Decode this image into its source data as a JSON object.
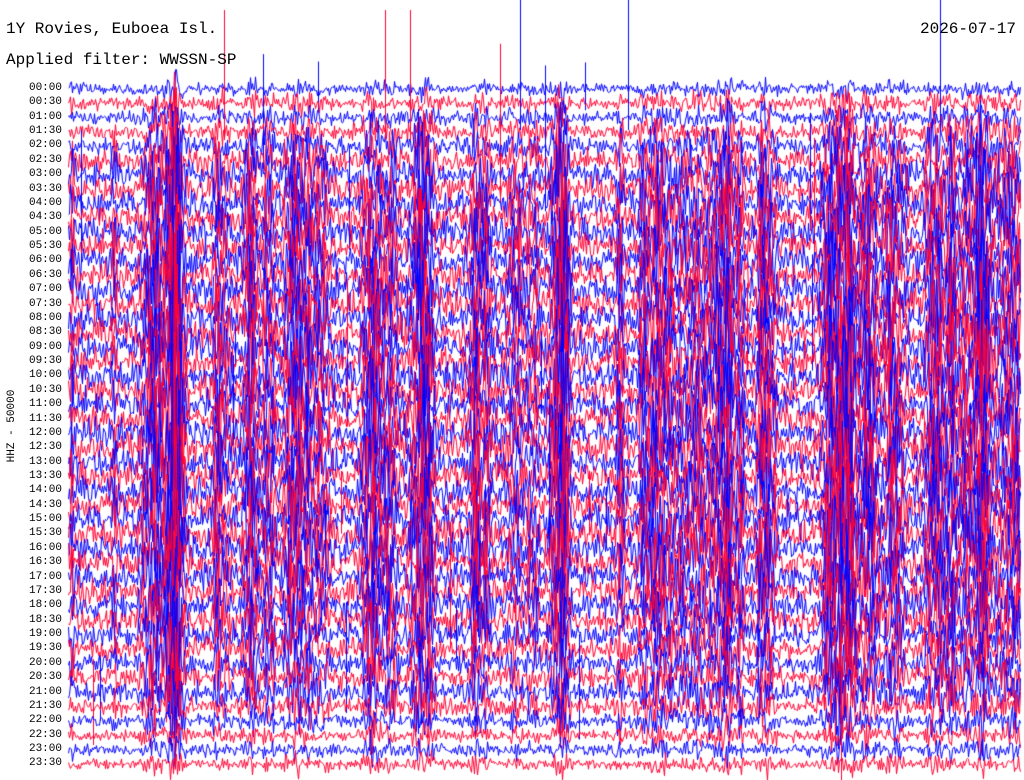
{
  "header": {
    "station": "1Y Rovies, Euboea Isl.",
    "filter": "Applied filter: WWSSN-SP",
    "date": "2026-07-17"
  },
  "chart_data": {
    "type": "line",
    "title": "1Y Rovies, Euboea Isl.",
    "subtitle": "Applied filter: WWSSN-SP",
    "ylabel": "HHZ - 50000",
    "row_labels": [
      "00:00",
      "00:30",
      "01:00",
      "01:30",
      "02:00",
      "02:30",
      "03:00",
      "03:30",
      "04:00",
      "04:30",
      "05:00",
      "05:30",
      "06:00",
      "06:30",
      "07:00",
      "07:30",
      "08:00",
      "08:30",
      "09:00",
      "09:30",
      "10:00",
      "10:30",
      "11:00",
      "11:30",
      "12:00",
      "12:30",
      "13:00",
      "13:30",
      "14:00",
      "14:30",
      "15:00",
      "15:30",
      "16:00",
      "16:30",
      "17:00",
      "17:30",
      "18:00",
      "18:30",
      "19:00",
      "19:30",
      "20:00",
      "20:30",
      "21:00",
      "21:30",
      "22:00",
      "22:30",
      "23:00",
      "23:30"
    ],
    "row_colors": [
      "#0000ff",
      "#ff0033"
    ],
    "row_activity": [
      0.18,
      0.3,
      0.32,
      0.45,
      0.6,
      0.8,
      0.95,
      1.0,
      1.05,
      1.1,
      1.1,
      1.1,
      1.15,
      1.15,
      1.2,
      1.2,
      1.2,
      1.2,
      1.2,
      1.2,
      1.2,
      1.2,
      1.2,
      1.2,
      1.2,
      1.2,
      1.2,
      1.2,
      1.2,
      1.2,
      1.2,
      1.2,
      1.2,
      1.2,
      1.15,
      1.1,
      1.0,
      0.95,
      0.9,
      0.85,
      0.8,
      0.75,
      0.7,
      0.55,
      0.4,
      0.3,
      0.25,
      0.2
    ],
    "grid": false,
    "legend": "none"
  }
}
